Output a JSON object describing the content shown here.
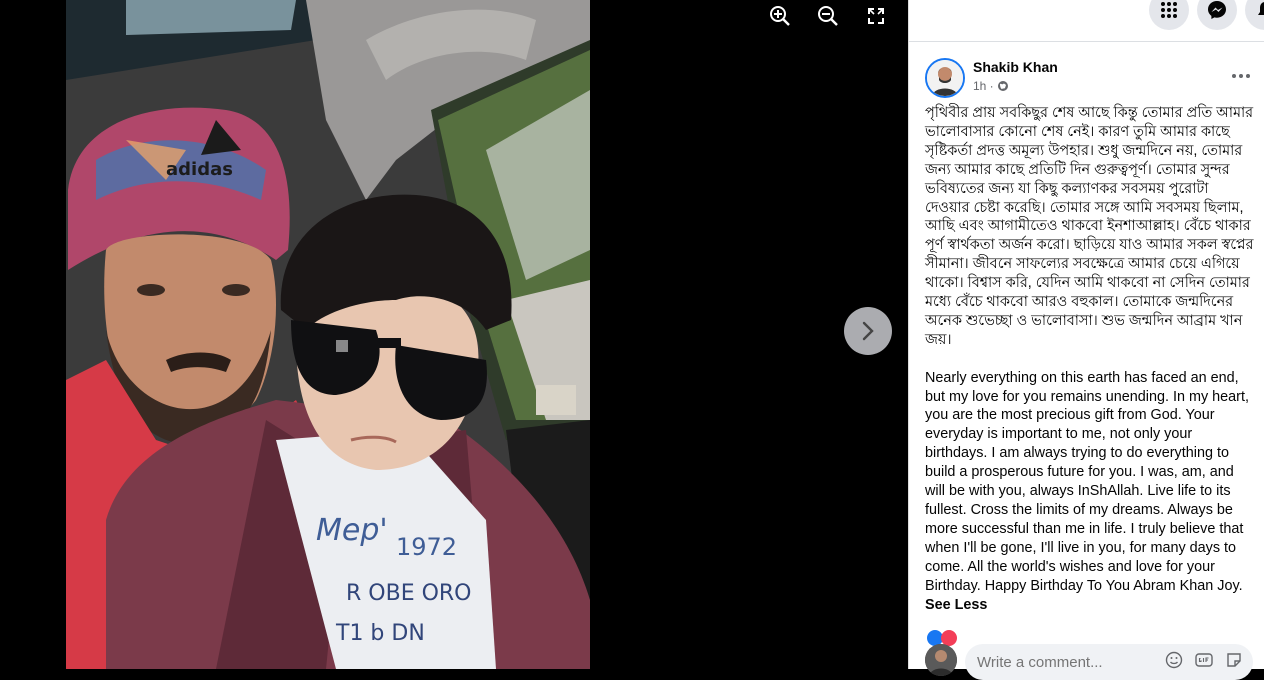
{
  "viewer": {
    "tools": [
      "zoom-in",
      "zoom-out",
      "fullscreen"
    ]
  },
  "topbar": {
    "icons": [
      "menu-grid-icon",
      "messenger-icon",
      "notifications-icon"
    ]
  },
  "post": {
    "author": "Shakib Khan",
    "time": "1h · ",
    "privacy_icon": "globe-icon",
    "text_bn": "পৃথিবীর প্রায় সবকিছুর শেষ আছে কিন্তু তোমার প্রতি আমার ভালোবাসার কোনো শেষ নেই। কারণ তুমি আমার কাছে সৃষ্টিকর্তা প্রদত্ত অমূল্য উপহার। শুধু জন্মদিনে নয়, তোমার জন্য আমার কাছে প্রতিটি দিন গুরুত্বপূর্ণ। তোমার সুন্দর ভবিষ্যতের জন্য যা কিছু কল্যাণকর সবসময় পুরোটা দেওয়ার চেষ্টা করেছি। তোমার সঙ্গে আমি সবসময় ছিলাম, আছি এবং আগামীতেও থাকবো ইনশাআল্লাহ। বেঁচে থাকার পূর্ণ স্বার্থকতা অর্জন করো। ছাড়িয়ে যাও আমার সকল স্বপ্নের সীমানা। জীবনে সাফল্যের সবক্ষেত্রে আমার চেয়ে এগিয়ে থাকো। বিশ্বাস করি, যেদিন আমি থাকবো না সেদিন তোমার মধ্যে বেঁচে থাকবো আরও বহুকাল। তোমাকে জন্মদিনের অনেক শুভেচ্ছা ও ভালোবাসা। শুভ জন্মদিন আব্রাম খান জয়।",
    "text_en": "Nearly everything on this earth has faced an end, but my love for you remains unending. In my heart, you are the most precious gift from God. Your everyday is important to me, not only your birthdays. I am always trying to do everything to build a prosperous future for you. I was, am, and will be with you, always InShAllah. Live life to its fullest. Cross the limits of my dreams. Always be more successful than me in life. I truly believe that when I'll be gone, I'll live in you, for many days to come. All the world's wishes and love for your Birthday. Happy Birthday To You Abram Khan Joy. ",
    "see_less": "See Less"
  },
  "comment": {
    "placeholder": "Write a comment..."
  },
  "colors": {
    "accent": "#1877f2",
    "panel_bg": "#ffffff",
    "input_bg": "#f0f2f5"
  }
}
